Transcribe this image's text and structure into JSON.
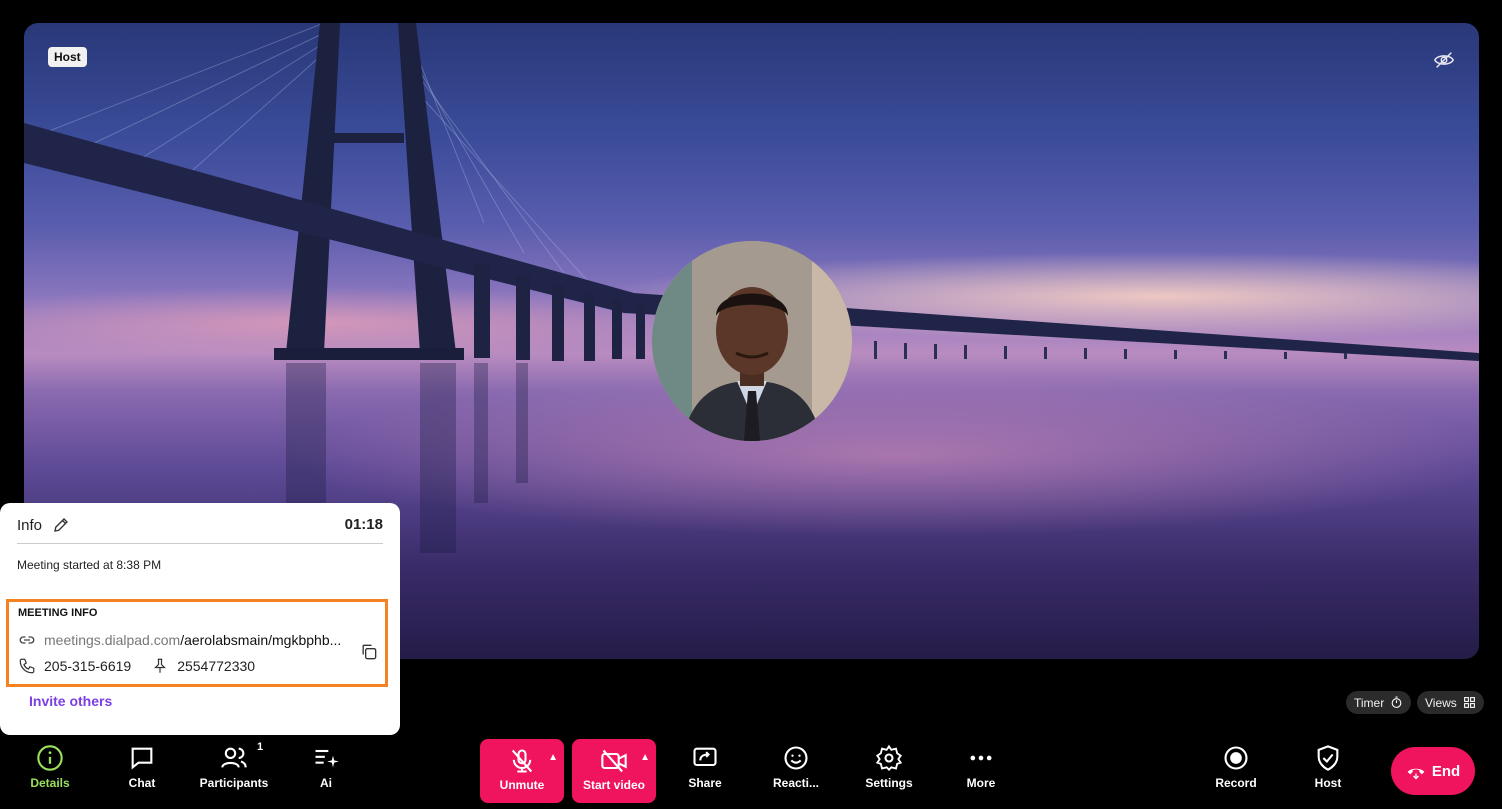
{
  "stage": {
    "host_tag": "Host"
  },
  "info_panel": {
    "title": "Info",
    "elapsed": "01:18",
    "started": "Meeting started at 8:38 PM",
    "meeting_info": {
      "title": "MEETING INFO",
      "link_domain": "meetings.dialpad.com",
      "link_path": "/aerolabsmain/mgkbphb...",
      "phone": "205-315-6619",
      "pin": "2554772330"
    },
    "invite": "Invite others"
  },
  "chips": {
    "timer": "Timer",
    "views": "Views"
  },
  "toolbar": {
    "details": "Details",
    "chat": "Chat",
    "participants": "Participants",
    "participants_count": "1",
    "ai": "Ai",
    "unmute": "Unmute",
    "start_video": "Start video",
    "share": "Share",
    "reactions": "Reacti...",
    "settings": "Settings",
    "more": "More",
    "record": "Record",
    "host": "Host",
    "end": "End"
  },
  "colors": {
    "accent_pink": "#f0135e",
    "details_active": "#9be15d",
    "invite_link": "#7b3fe4",
    "highlight_box": "#f58220"
  }
}
